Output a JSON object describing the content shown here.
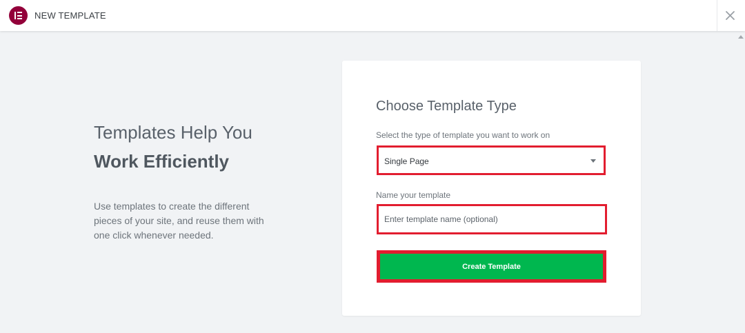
{
  "header": {
    "title": "NEW TEMPLATE",
    "logo_icon": "elementor-logo-icon",
    "close_icon": "close-icon",
    "brand_color": "#93003a"
  },
  "intro": {
    "headline_line1": "Templates Help You",
    "headline_line2": "Work Efficiently",
    "description": "Use templates to create the different pieces of your site, and reuse them with one click whenever needed."
  },
  "form": {
    "title": "Choose Template Type",
    "type_label": "Select the type of template you want to work on",
    "type_selected": "Single Page",
    "name_label": "Name your template",
    "name_placeholder": "Enter template name (optional)",
    "name_value": "",
    "submit_label": "Create Template",
    "highlight_color": "#e21d2f",
    "submit_color": "#00b74f"
  }
}
